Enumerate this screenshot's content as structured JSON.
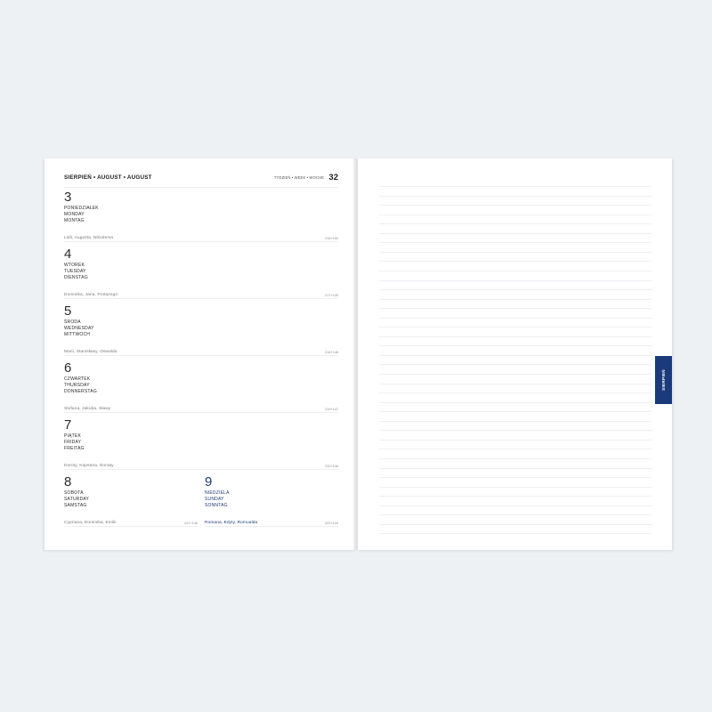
{
  "header": {
    "month_title": "SIERPIEŃ • AUGUST • AUGUST",
    "week_label": "TYDZIEŃ • WEEK • WOCHE",
    "week_number": "32"
  },
  "days": [
    {
      "number": "3",
      "names": [
        "PONIEDZIAŁEK",
        "MONDAY",
        "MONTAG"
      ],
      "nameday": "Lidii, Augusta, Nikodema",
      "daycount": "216+150"
    },
    {
      "number": "4",
      "names": [
        "WTOREK",
        "TUESDAY",
        "DIENSTAG"
      ],
      "nameday": "Dominika, Jana, Protazego",
      "daycount": "217+149"
    },
    {
      "number": "5",
      "names": [
        "ŚRODA",
        "WEDNESDAY",
        "MITTWOCH"
      ],
      "nameday": "Marii, Stanisławy, Oswalda",
      "daycount": "218+148"
    },
    {
      "number": "6",
      "names": [
        "CZWARTEK",
        "THURSDAY",
        "DONNERSTAG"
      ],
      "nameday": "Stefana, Jakuba, Sławy",
      "daycount": "219+147"
    },
    {
      "number": "7",
      "names": [
        "PIĄTEK",
        "FRIDAY",
        "FREITAG"
      ],
      "nameday": "Doroty, Kajetana, Donaty",
      "daycount": "220+146"
    },
    {
      "number": "8",
      "names": [
        "SOBOTA",
        "SATURDAY",
        "SAMSTAG"
      ],
      "nameday": "Cypriana, Dominika, Emilii",
      "daycount": "221+145"
    },
    {
      "number": "9",
      "names": [
        "NIEDZIELA",
        "SUNDAY",
        "SONNTAG"
      ],
      "nameday": "Romana, Edyty, Romualda",
      "daycount": "222+144"
    }
  ],
  "tab": {
    "label": "SIERPIEŃ"
  },
  "colors": {
    "accent": "#1b3a7c",
    "background": "#eef1f4",
    "page": "#ffffff"
  }
}
